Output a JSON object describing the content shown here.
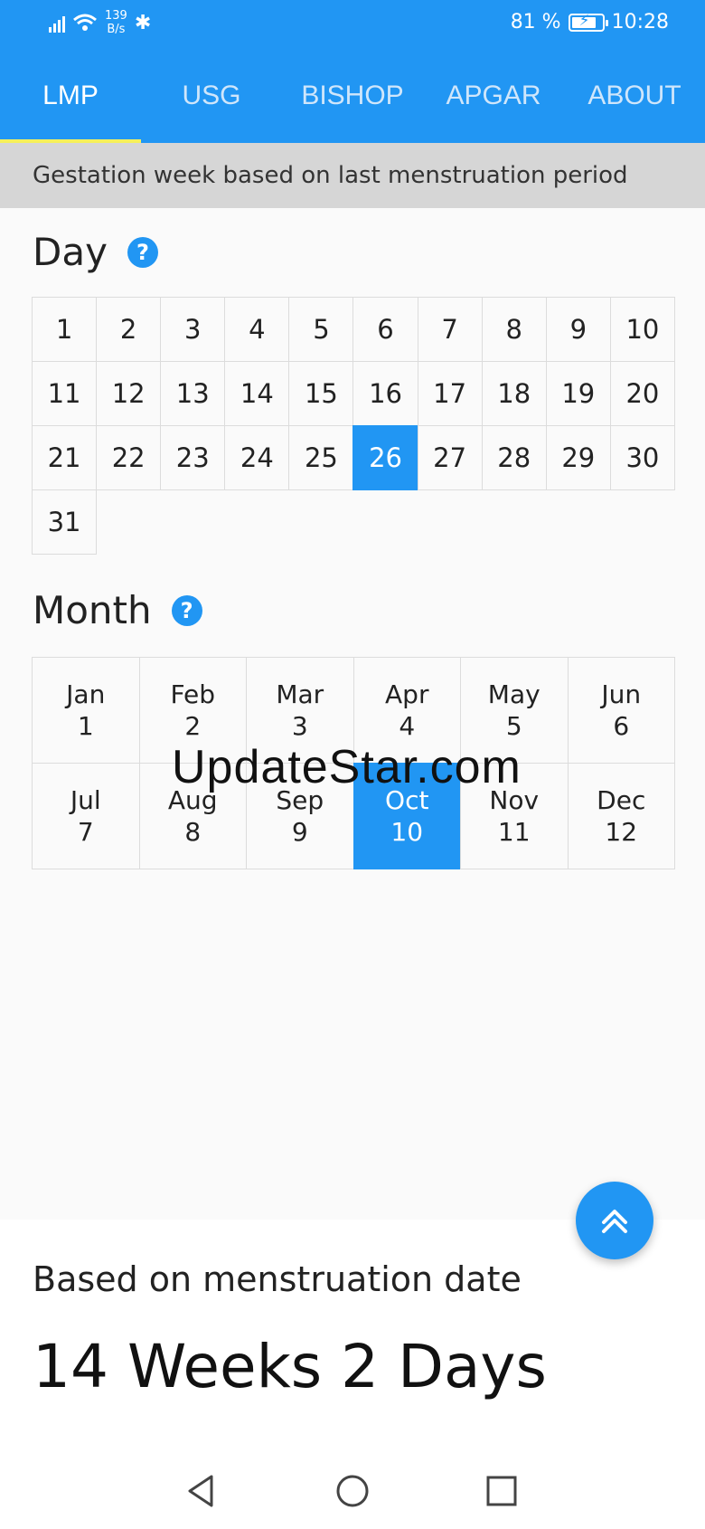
{
  "status_bar": {
    "speed_value": "139",
    "speed_unit": "B/s",
    "battery_percent": "81 %",
    "battery_level": 0.81,
    "time": "10:28"
  },
  "tabs": [
    {
      "label": "LMP",
      "active": true
    },
    {
      "label": "USG",
      "active": false
    },
    {
      "label": "BISHOP",
      "active": false
    },
    {
      "label": "APGAR",
      "active": false
    },
    {
      "label": "ABOUT",
      "active": false
    }
  ],
  "subtitle": "Gestation week based on last menstruation period",
  "day_section": {
    "title": "Day",
    "days": [
      "1",
      "2",
      "3",
      "4",
      "5",
      "6",
      "7",
      "8",
      "9",
      "10",
      "11",
      "12",
      "13",
      "14",
      "15",
      "16",
      "17",
      "18",
      "19",
      "20",
      "21",
      "22",
      "23",
      "24",
      "25",
      "26",
      "27",
      "28",
      "29",
      "30",
      "31"
    ],
    "selected": "26"
  },
  "month_section": {
    "title": "Month",
    "months": [
      {
        "name": "Jan",
        "num": "1"
      },
      {
        "name": "Feb",
        "num": "2"
      },
      {
        "name": "Mar",
        "num": "3"
      },
      {
        "name": "Apr",
        "num": "4"
      },
      {
        "name": "May",
        "num": "5"
      },
      {
        "name": "Jun",
        "num": "6"
      },
      {
        "name": "Jul",
        "num": "7"
      },
      {
        "name": "Aug",
        "num": "8"
      },
      {
        "name": "Sep",
        "num": "9"
      },
      {
        "name": "Oct",
        "num": "10"
      },
      {
        "name": "Nov",
        "num": "11"
      },
      {
        "name": "Dec",
        "num": "12"
      }
    ],
    "selected": "10"
  },
  "watermark": "UpdateStar.com",
  "result": {
    "label": "Based on menstruation date",
    "value": "14 Weeks 2 Days"
  },
  "icons": {
    "help": "question-circle-icon",
    "fab": "double-chevron-up-icon",
    "nav_back": "triangle-back-icon",
    "nav_home": "circle-home-icon",
    "nav_recents": "square-recents-icon"
  },
  "colors": {
    "accent": "#2196f3",
    "tab_indicator": "#f6f05a"
  }
}
